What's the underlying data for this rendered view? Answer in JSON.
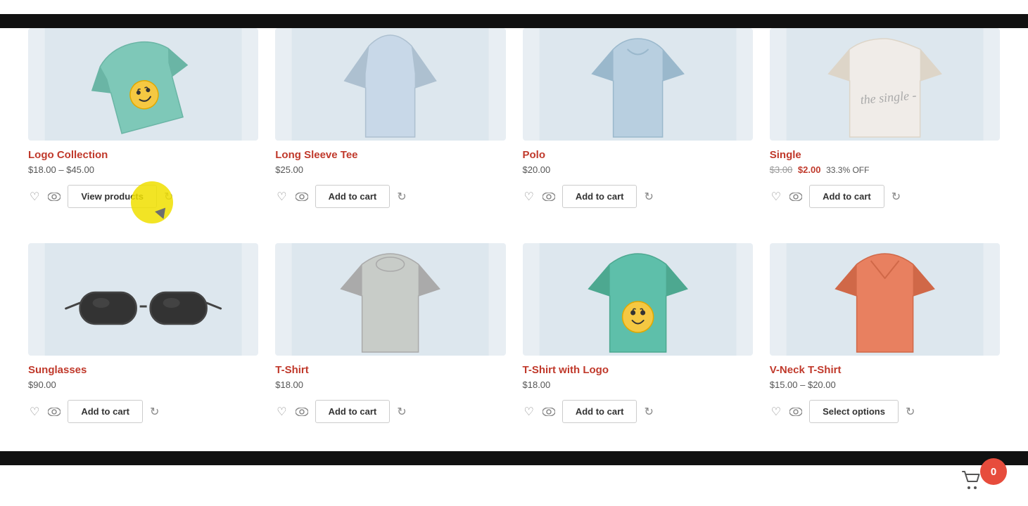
{
  "page": {
    "background_top": "#111",
    "background_bottom": "#111"
  },
  "products_row1": [
    {
      "id": "logo-collection",
      "name": "Logo Collection",
      "price_min": "$18.00",
      "price_max": "$45.00",
      "price_display": "$18.00 – $45.00",
      "action": "View products",
      "action_type": "view",
      "image_type": "logo-collection"
    },
    {
      "id": "long-sleeve-tee",
      "name": "Long Sleeve Tee",
      "price_display": "$25.00",
      "action": "Add to cart",
      "action_type": "cart",
      "image_type": "long-sleeve"
    },
    {
      "id": "polo",
      "name": "Polo",
      "price_display": "$20.00",
      "action": "Add to cart",
      "action_type": "cart",
      "image_type": "polo"
    },
    {
      "id": "single",
      "name": "Single",
      "price_original": "$3.00",
      "price_sale": "$2.00",
      "discount": "33.3% OFF",
      "action": "Add to cart",
      "action_type": "cart",
      "image_type": "single"
    }
  ],
  "products_row2": [
    {
      "id": "sunglasses",
      "name": "Sunglasses",
      "price_display": "$90.00",
      "action": "Add to cart",
      "action_type": "cart",
      "image_type": "sunglasses"
    },
    {
      "id": "tshirt",
      "name": "T-Shirt",
      "price_display": "$18.00",
      "action": "Add to cart",
      "action_type": "cart",
      "image_type": "tshirt"
    },
    {
      "id": "tshirt-logo",
      "name": "T-Shirt with Logo",
      "price_display": "$18.00",
      "action": "Add to cart",
      "action_type": "cart",
      "image_type": "tshirt-logo"
    },
    {
      "id": "vneck-tshirt",
      "name": "V-Neck T-Shirt",
      "price_min": "$15.00",
      "price_max": "$20.00",
      "price_display": "$15.00 – $20.00",
      "action": "Select options",
      "action_type": "options",
      "image_type": "vneck"
    }
  ],
  "cart": {
    "count": "0"
  },
  "icons": {
    "heart": "♡",
    "eye": "👁",
    "refresh": "↻"
  }
}
